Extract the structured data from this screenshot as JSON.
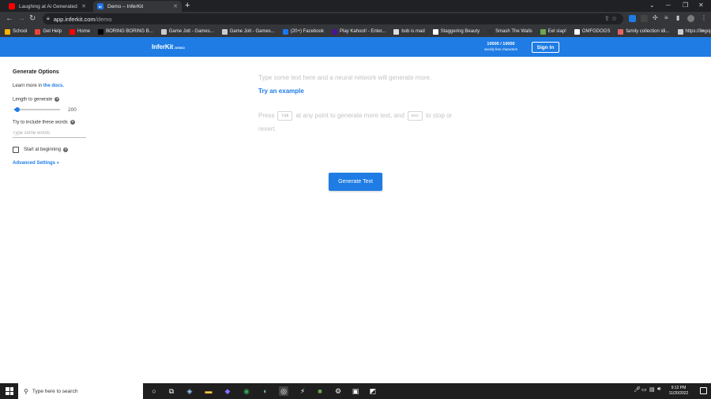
{
  "browser": {
    "tabs": [
      {
        "title": "Laughing at Ai Generated Storie",
        "favicon": "youtube-icon",
        "active": false
      },
      {
        "title": "Demo – InferKit",
        "favicon": "inferkit-icon",
        "active": true
      }
    ],
    "new_tab": "+",
    "address": {
      "host": "app.inferkit.com",
      "path": "/demo"
    },
    "bookmarks": [
      {
        "label": "School",
        "color": "#f4b400"
      },
      {
        "label": "Get Help",
        "color": "#ea4335"
      },
      {
        "label": "Home",
        "color": "#ff0000"
      },
      {
        "label": "BORING BORING B...",
        "color": "#000000"
      },
      {
        "label": "Game Jolt - Games...",
        "color": "#cccccc"
      },
      {
        "label": "Game Jolt - Games...",
        "color": "#cccccc"
      },
      {
        "label": "(20+) Facebook",
        "color": "#1877f2"
      },
      {
        "label": "Play Kahoot! - Enter...",
        "color": "#46178f"
      },
      {
        "label": "bob is mad",
        "color": "#dddddd"
      },
      {
        "label": "Staggering Beauty",
        "color": "#ffffff"
      },
      {
        "label": "Smash The Walls",
        "color": "#333333"
      },
      {
        "label": "Eel slap!",
        "color": "#6aa84f"
      },
      {
        "label": "OMFGDOGS",
        "color": "#ffffff"
      },
      {
        "label": "family collection idi...",
        "color": "#e06666"
      },
      {
        "label": "https://lingojam.co...",
        "color": "#cccccc"
      }
    ],
    "bookmarks_more": "»"
  },
  "app": {
    "logo": "InferKit",
    "logo_badge": "DEMO",
    "quota_value": "10000 / 10000",
    "quota_label": "weekly free characters",
    "signin": "Sign In",
    "brand_color": "#1e7ce4"
  },
  "sidebar": {
    "title": "Generate Options",
    "learn_prefix": "Learn more in ",
    "learn_link": "the docs.",
    "length_label": "Length to generate",
    "length_value": "200",
    "length_fraction": 0.07,
    "try_words_label": "Try to include these words",
    "try_words_placeholder": "Type some words",
    "start_label": "Start at beginning",
    "start_checked": false,
    "advanced": "Advanced Settings »"
  },
  "editor": {
    "placeholder": "Type some text here and a neural network will generate more.",
    "try_example": "Try an example",
    "press": "Press",
    "tab_key": "tab",
    "middle": "at any point to generate more text, and",
    "esc_key": "esc",
    "tail": "to stop or revert."
  },
  "generate_button": "Generate Text",
  "taskbar": {
    "search_placeholder": "Type here to search",
    "time": "9:12 PM",
    "date": "11/20/2022"
  }
}
